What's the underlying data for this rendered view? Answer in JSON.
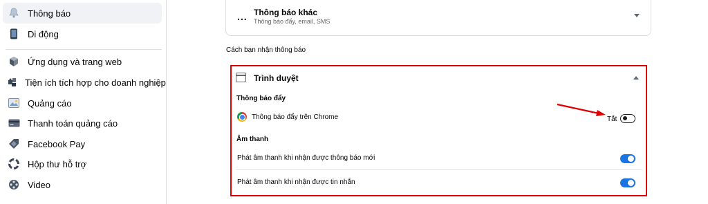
{
  "sidebar": {
    "items": [
      {
        "label": "Thông báo",
        "icon": "bell-icon"
      },
      {
        "label": "Di động",
        "icon": "mobile-icon"
      },
      {
        "label": "Ứng dụng và trang web",
        "icon": "cube-icon"
      },
      {
        "label": "Tiện ích tích hợp cho doanh nghiệp",
        "icon": "puzzle-icon"
      },
      {
        "label": "Quảng cáo",
        "icon": "ad-image-icon"
      },
      {
        "label": "Thanh toán quảng cáo",
        "icon": "credit-card-icon"
      },
      {
        "label": "Facebook Pay",
        "icon": "pay-tag-icon"
      },
      {
        "label": "Hộp thư hỗ trợ",
        "icon": "lifebuoy-icon"
      },
      {
        "label": "Video",
        "icon": "film-reel-icon"
      }
    ]
  },
  "other_notifications": {
    "dots": "...",
    "title": "Thông báo khác",
    "subtitle": "Thông báo đẩy, email, SMS"
  },
  "delivery": {
    "heading": "Cách bạn nhận thông báo"
  },
  "browser": {
    "title": "Trình duyệt",
    "push_heading": "Thông báo đẩy",
    "chrome_label": "Thông báo đẩy trên Chrome",
    "chrome_state": "Tắt",
    "chrome_enabled": false,
    "sound_heading": "Âm thanh",
    "sound_new_notification_label": "Phát âm thanh khi nhận được thông báo mới",
    "sound_new_notification_enabled": true,
    "sound_new_message_label": "Phát âm thanh khi nhận được tin nhắn",
    "sound_new_message_enabled": true
  },
  "colors": {
    "accent": "#1b74e4",
    "highlight_border": "#e00000",
    "arrow": "#e00000"
  }
}
